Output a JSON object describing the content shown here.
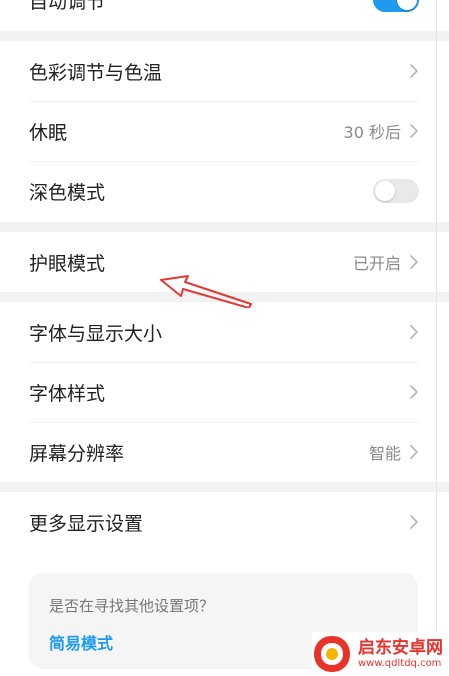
{
  "top_partial": {
    "label": "自动调节",
    "toggle_on": true
  },
  "group1": [
    {
      "label": "色彩调节与色温",
      "value": "",
      "type": "chevron"
    },
    {
      "label": "休眠",
      "value": "30 秒后",
      "type": "chevron"
    },
    {
      "label": "深色模式",
      "value": "",
      "type": "toggle",
      "toggle_on": false
    }
  ],
  "group2": [
    {
      "label": "护眼模式",
      "value": "已开启",
      "type": "chevron"
    }
  ],
  "group3": [
    {
      "label": "字体与显示大小",
      "value": "",
      "type": "chevron"
    },
    {
      "label": "字体样式",
      "value": "",
      "type": "chevron"
    },
    {
      "label": "屏幕分辨率",
      "value": "智能",
      "type": "chevron"
    }
  ],
  "group4": [
    {
      "label": "更多显示设置",
      "value": "",
      "type": "chevron"
    }
  ],
  "suggestion_card": {
    "question": "是否在寻找其他设置项？",
    "link": "简易模式"
  },
  "watermark": {
    "name": "启东安卓网",
    "url": "www.qdltdq.com"
  },
  "colors": {
    "accent": "#1e9bf0",
    "annotation_arrow": "#e03a3a",
    "watermark": "#e8332b"
  }
}
